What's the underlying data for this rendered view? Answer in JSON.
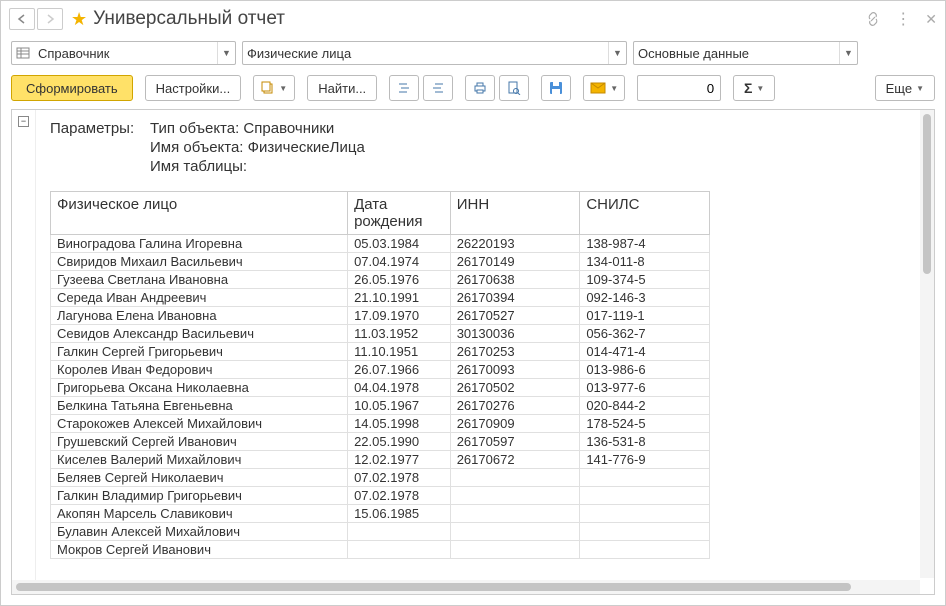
{
  "title": "Универсальный отчет",
  "filters": {
    "type": "Справочник",
    "object": "Физические лица",
    "data": "Основные данные"
  },
  "toolbar": {
    "generate": "Сформировать",
    "settings": "Настройки...",
    "find": "Найти...",
    "more": "Еще",
    "num_value": "0"
  },
  "params": {
    "label": "Параметры:",
    "lines": [
      "Тип объекта: Справочники",
      "Имя объекта: ФизическиеЛица",
      "Имя таблицы:"
    ]
  },
  "table": {
    "headers": {
      "name": "Физическое лицо",
      "birth": "Дата рождения",
      "inn": "ИНН",
      "snils": "СНИЛС"
    },
    "rows": [
      {
        "name": "Виноградова Галина Игоревна",
        "birth": "05.03.1984",
        "inn": "26220193",
        "snils": "138-987-4"
      },
      {
        "name": "Свиридов Михаил Васильевич",
        "birth": "07.04.1974",
        "inn": "26170149",
        "snils": "134-011-8"
      },
      {
        "name": "Гузеева Светлана Ивановна",
        "birth": "26.05.1976",
        "inn": "26170638",
        "snils": "109-374-5"
      },
      {
        "name": "Середа Иван Андреевич",
        "birth": "21.10.1991",
        "inn": "26170394",
        "snils": "092-146-3"
      },
      {
        "name": "Лагунова Елена Ивановна",
        "birth": "17.09.1970",
        "inn": "26170527",
        "snils": "017-119-1"
      },
      {
        "name": "Севидов Александр Васильевич",
        "birth": "11.03.1952",
        "inn": "30130036",
        "snils": "056-362-7"
      },
      {
        "name": "Галкин Сергей Григорьевич",
        "birth": "11.10.1951",
        "inn": "26170253",
        "snils": "014-471-4"
      },
      {
        "name": "Королев Иван Федорович",
        "birth": "26.07.1966",
        "inn": "26170093",
        "snils": "013-986-6"
      },
      {
        "name": "Григорьева Оксана Николаевна",
        "birth": "04.04.1978",
        "inn": "26170502",
        "snils": "013-977-6"
      },
      {
        "name": "Белкина Татьяна Евгеньевна",
        "birth": "10.05.1967",
        "inn": "26170276",
        "snils": "020-844-2"
      },
      {
        "name": "Старокожев Алексей Михайлович",
        "birth": "14.05.1998",
        "inn": "26170909",
        "snils": "178-524-5"
      },
      {
        "name": "Грушевский Сергей Иванович",
        "birth": "22.05.1990",
        "inn": "26170597",
        "snils": "136-531-8"
      },
      {
        "name": "Киселев Валерий Михайлович",
        "birth": "12.02.1977",
        "inn": "26170672",
        "snils": "141-776-9"
      },
      {
        "name": "Беляев Сергей Николаевич",
        "birth": "07.02.1978",
        "inn": "",
        "snils": ""
      },
      {
        "name": "Галкин Владимир Григорьевич",
        "birth": "07.02.1978",
        "inn": "",
        "snils": ""
      },
      {
        "name": "Акопян Марсель Славикович",
        "birth": "15.06.1985",
        "inn": "",
        "snils": ""
      },
      {
        "name": "Булавин Алексей Михайлович",
        "birth": "",
        "inn": "",
        "snils": ""
      },
      {
        "name": "Мокров Сергей Иванович",
        "birth": "",
        "inn": "",
        "snils": ""
      }
    ]
  }
}
